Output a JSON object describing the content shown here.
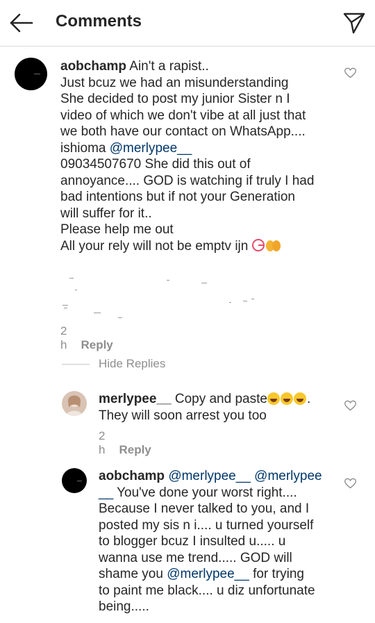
{
  "header": {
    "title": "Comments",
    "back_icon": "arrow-left-icon",
    "send_icon": "paper-plane-icon"
  },
  "comments": [
    {
      "username": "aobchamp",
      "text_lines": [
        "Ain't a rapist..",
        "Just bcuz we had an misunderstanding",
        "She decided to post my junior Sister n I",
        "video of which we don't vibe at all just that",
        "we both have our contact on WhatsApp....",
        "ishioma ",
        "09034507670  She did this out of",
        "annoyance.... GOD is watching if truly I had",
        "bad intentions but if not your Generation",
        "will suffer for it..",
        "Please help me out",
        "All your rely will not be emptv ijn "
      ],
      "mention": "@merlypee__",
      "time": "2 h",
      "reply_label": "Reply"
    }
  ],
  "hide_replies_label": "Hide Replies",
  "replies": [
    {
      "username": "merlypee__",
      "text_a": "Copy and paste",
      "text_b": ".",
      "text_c": "They will soon arrest you too",
      "time": "2 h",
      "reply_label": "Reply"
    },
    {
      "username": "aobchamp",
      "mention_1": "@merlypee__",
      "mention_2": "@merlypee",
      "mention_2b": "__",
      "body_1": "You've done your worst right....",
      "body_2": "Because I never talked to you, and I",
      "body_3": "posted my sis n i.... u turned yourself",
      "body_4": "to blogger bcuz I insulted u..... u",
      "body_5": "wanna use me trend..... GOD will",
      "body_6a": "shame you ",
      "mention_3": "@merlypee__",
      "body_6b": "  for trying",
      "body_7": "to paint me black.... u diz unfortunate",
      "body_8": "being....."
    }
  ],
  "colors": {
    "text": "#262626",
    "secondary": "#8e8e8e",
    "mention": "#00376b",
    "divider": "#dbdbdb"
  }
}
